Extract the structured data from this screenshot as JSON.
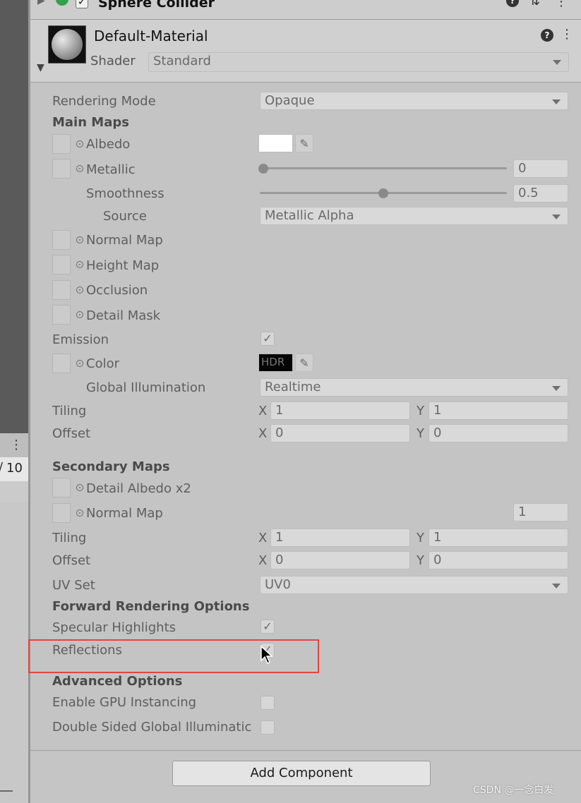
{
  "component": {
    "name": "Sphere Collider"
  },
  "material": {
    "name": "Default-Material",
    "shader_label": "Shader",
    "shader_value": "Standard"
  },
  "left_panel": {
    "count_text": "10"
  },
  "rows": {
    "rendering_mode": {
      "label": "Rendering Mode",
      "value": "Opaque"
    },
    "main_maps": "Main Maps",
    "albedo": "Albedo",
    "metallic": {
      "label": "Metallic",
      "value": "0",
      "level": 0.0
    },
    "smoothness": {
      "label": "Smoothness",
      "value": "0.5",
      "level": 0.5
    },
    "source": {
      "label": "Source",
      "value": "Metallic Alpha"
    },
    "normal_map": "Normal Map",
    "height_map": "Height Map",
    "occlusion": "Occlusion",
    "detail_mask": "Detail Mask",
    "emission": {
      "label": "Emission",
      "checked": true
    },
    "color": {
      "label": "Color",
      "hdr": "HDR"
    },
    "global_illumination": {
      "label": "Global Illumination",
      "value": "Realtime"
    },
    "tiling": {
      "label": "Tiling",
      "x_label": "X",
      "x": "1",
      "y_label": "Y",
      "y": "1"
    },
    "offset": {
      "label": "Offset",
      "x_label": "X",
      "x": "0",
      "y_label": "Y",
      "y": "0"
    },
    "secondary_maps": "Secondary Maps",
    "detail_albedo": "Detail Albedo x2",
    "normal_map2": {
      "label": "Normal Map",
      "value": "1"
    },
    "tiling2": {
      "label": "Tiling",
      "x_label": "X",
      "x": "1",
      "y_label": "Y",
      "y": "1"
    },
    "offset2": {
      "label": "Offset",
      "x_label": "X",
      "x": "0",
      "y_label": "Y",
      "y": "0"
    },
    "uv_set": {
      "label": "UV Set",
      "value": "UV0"
    },
    "forward_rendering": "Forward Rendering Options",
    "specular_highlights": {
      "label": "Specular Highlights",
      "checked": true
    },
    "reflections": {
      "label": "Reflections",
      "checked": true
    },
    "advanced_options": "Advanced Options",
    "gpu_instancing": {
      "label": "Enable GPU Instancing",
      "checked": false
    },
    "double_sided_gi": {
      "label": "Double Sided Global Illuminatic",
      "checked": false
    }
  },
  "add_component": "Add Component",
  "watermark": "CSDN @一念白发",
  "colors": {
    "highlight_box": "#e8433f",
    "checkmark": "#6a6a6a"
  }
}
